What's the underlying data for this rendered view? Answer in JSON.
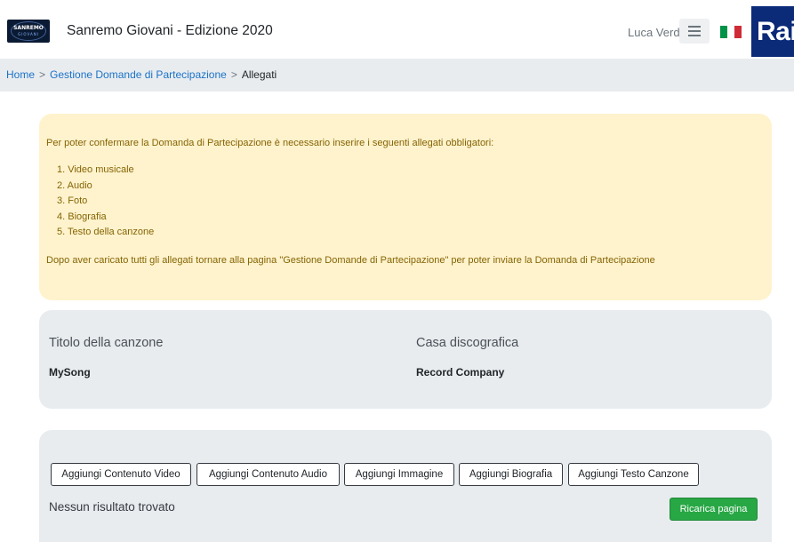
{
  "header": {
    "app_title": "Sanremo Giovani - Edizione 2020",
    "user_name": "Luca Verdi",
    "logo_text": "SANREMO",
    "logo_subtext": "GIOVANI",
    "rai_logo_text": "Rai",
    "flag_colors": [
      "#009246",
      "#ffffff",
      "#ce2b37"
    ]
  },
  "breadcrumb": {
    "items": [
      "Home",
      "Gestione Domande di Partecipazione"
    ],
    "current": "Allegati",
    "separator": ">"
  },
  "alert": {
    "intro": "Per poter confermare la Domanda di Partecipazione è necessario inserire i seguenti allegati obbligatori:",
    "items": [
      "1. Video musicale",
      "2. Audio",
      "3. Foto",
      "4. Biografia",
      "5. Testo della canzone"
    ],
    "outro": "Dopo aver caricato tutti gli allegati tornare alla pagina \"Gestione Domande di Partecipazione\" per poter inviare la Domanda di Partecipazione"
  },
  "song": {
    "title_label": "Titolo della canzone",
    "title_value": "MySong",
    "label_label": "Casa discografica",
    "label_value": "Record Company"
  },
  "attachments": {
    "buttons": [
      "Aggiungi Contenuto Video",
      "Aggiungi Contenuto Audio",
      "Aggiungi Immagine",
      "Aggiungi Biografia",
      "Aggiungi Testo Canzone"
    ],
    "empty_message": "Nessun risultato trovato",
    "reload_label": "Ricarica pagina"
  },
  "colors": {
    "alert_bg": "#fff3cd",
    "alert_text": "#856404",
    "card_bg": "#e9ecef",
    "link": "#1a73c8",
    "success": "#28a745",
    "rai_blue": "#0b2a78"
  }
}
